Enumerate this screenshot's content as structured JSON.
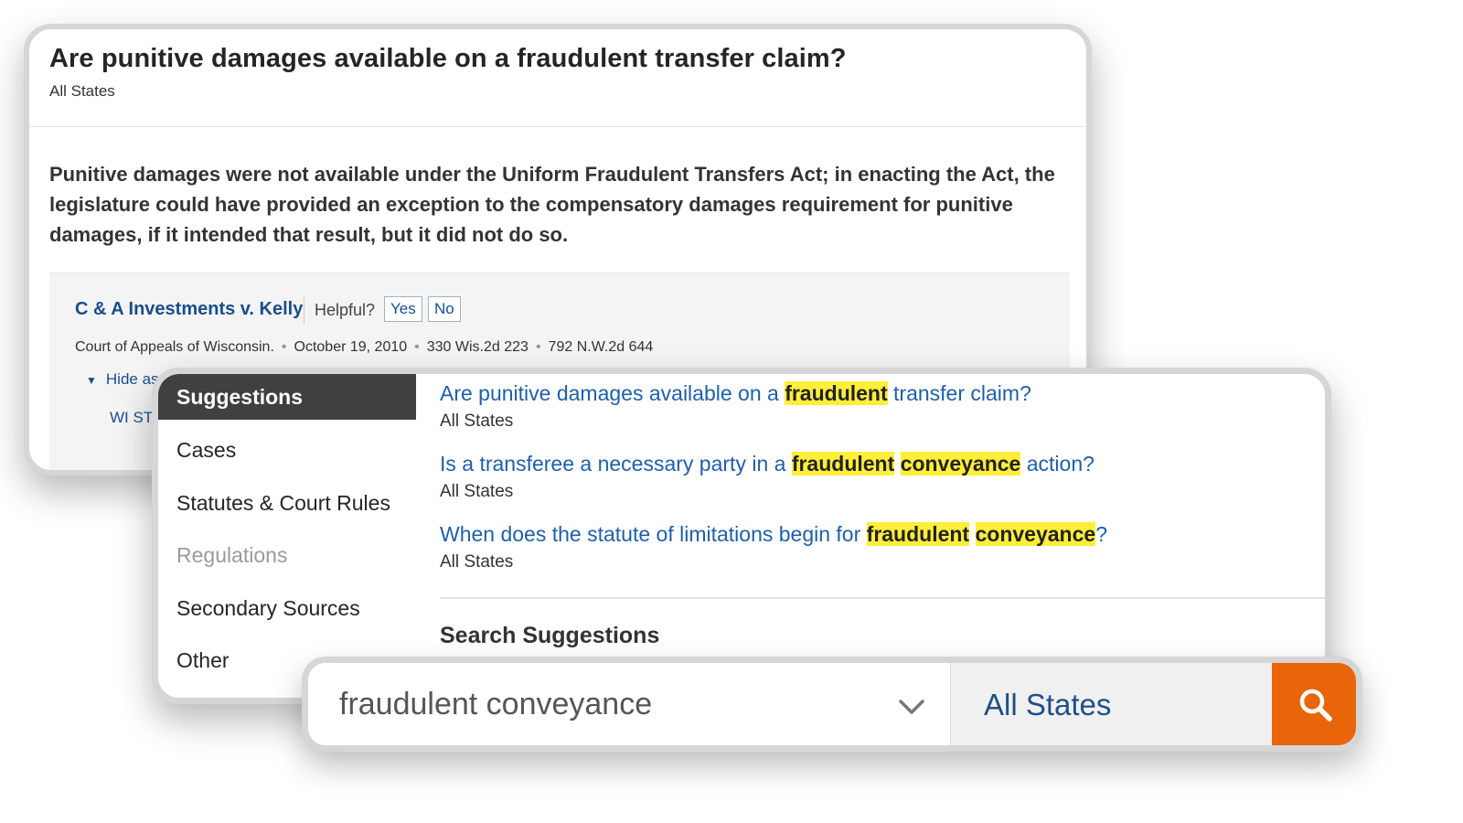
{
  "answer_card": {
    "question": "Are punitive damages available on a fraudulent transfer claim?",
    "jurisdiction": "All States",
    "answer": "Punitive damages were not available under the Uniform Fraudulent Transfers Act; in enacting the Act, the legislature could have provided an exception to the compensatory damages requirement for punitive damages, if it intended that result, but it did not do so.",
    "case": {
      "name": "C & A Investments v. Kelly",
      "helpful_label": "Helpful?",
      "yes_label": "Yes",
      "no_label": "No",
      "court": "Court of Appeals of Wisconsin.",
      "date": "October 19, 2010",
      "citation1": "330 Wis.2d 223",
      "citation2": "792 N.W.2d 644",
      "hide_link": "Hide as",
      "statute_link": "WI ST"
    }
  },
  "dropdown": {
    "categories": [
      {
        "label": "Suggestions",
        "state": "active"
      },
      {
        "label": "Cases",
        "state": "normal"
      },
      {
        "label": "Statutes & Court Rules",
        "state": "normal"
      },
      {
        "label": "Regulations",
        "state": "disabled"
      },
      {
        "label": "Secondary Sources",
        "state": "normal"
      },
      {
        "label": "Other",
        "state": "normal"
      }
    ],
    "suggestions": [
      {
        "parts": [
          {
            "text": "Are punitive damages available on a ",
            "hl": false
          },
          {
            "text": "fraudulent",
            "hl": true
          },
          {
            "text": " transfer claim?",
            "hl": false
          }
        ],
        "jurisdiction": "All States"
      },
      {
        "parts": [
          {
            "text": "Is a transferee a necessary party in a ",
            "hl": false
          },
          {
            "text": "fraudulent",
            "hl": true
          },
          {
            "text": " ",
            "hl": false
          },
          {
            "text": "conveyance",
            "hl": true
          },
          {
            "text": " action?",
            "hl": false
          }
        ],
        "jurisdiction": "All States"
      },
      {
        "parts": [
          {
            "text": "When does the statute of limitations begin for ",
            "hl": false
          },
          {
            "text": "fraudulent",
            "hl": true
          },
          {
            "text": " ",
            "hl": false
          },
          {
            "text": "conveyance",
            "hl": true
          },
          {
            "text": "?",
            "hl": false
          }
        ],
        "jurisdiction": "All States"
      }
    ],
    "search_suggestions_heading": "Search Suggestions"
  },
  "search": {
    "query": "fraudulent conveyance",
    "jurisdiction": "All States"
  },
  "colors": {
    "link": "#1f5fa8",
    "highlight": "#ffee3a",
    "search_button": "#e8650a",
    "active_category": "#404040"
  },
  "icons": {
    "search_button": "search-icon",
    "dropdown": "chevron-down-icon",
    "collapse": "triangle-down-icon"
  }
}
